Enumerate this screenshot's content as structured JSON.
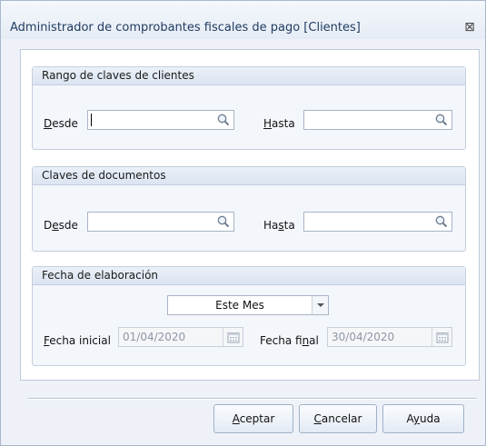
{
  "window": {
    "title": "Administrador de comprobantes fiscales de pago [Clientes]",
    "close_glyph": "⊠"
  },
  "groups": {
    "clientes": {
      "title": "Rango de claves de clientes",
      "desde_label": {
        "pre": "",
        "key": "D",
        "post": "esde"
      },
      "hasta_label": {
        "pre": "",
        "key": "H",
        "post": "asta"
      },
      "desde_value": "",
      "hasta_value": ""
    },
    "documentos": {
      "title": "Claves de documentos",
      "desde_label": {
        "pre": "D",
        "key": "e",
        "post": "sde"
      },
      "hasta_label": {
        "pre": "Ha",
        "key": "s",
        "post": "ta"
      },
      "desde_value": "",
      "hasta_value": ""
    },
    "fecha": {
      "title": "Fecha de elaboración",
      "period_selected": "Este Mes",
      "inicial_label": {
        "pre": "",
        "key": "F",
        "post": "echa inicial"
      },
      "inicial_value": "01/04/2020",
      "final_label": {
        "pre": "Fecha fi",
        "key": "n",
        "post": "al"
      },
      "final_value": "30/04/2020"
    }
  },
  "buttons": {
    "aceptar": {
      "pre": "",
      "key": "A",
      "post": "ceptar"
    },
    "cancelar": {
      "pre": "",
      "key": "C",
      "post": "ancelar"
    },
    "ayuda": {
      "pre": "A",
      "key": "y",
      "post": "uda"
    }
  },
  "icons": {
    "lookup": "magnifier-icon",
    "dropdown": "chevron-down-icon",
    "calendar": "calendar-icon",
    "close": "close-icon"
  },
  "colors": {
    "window_bg": "#eef2f8",
    "title_text": "#1e3a5f",
    "border": "#aab8cc"
  }
}
